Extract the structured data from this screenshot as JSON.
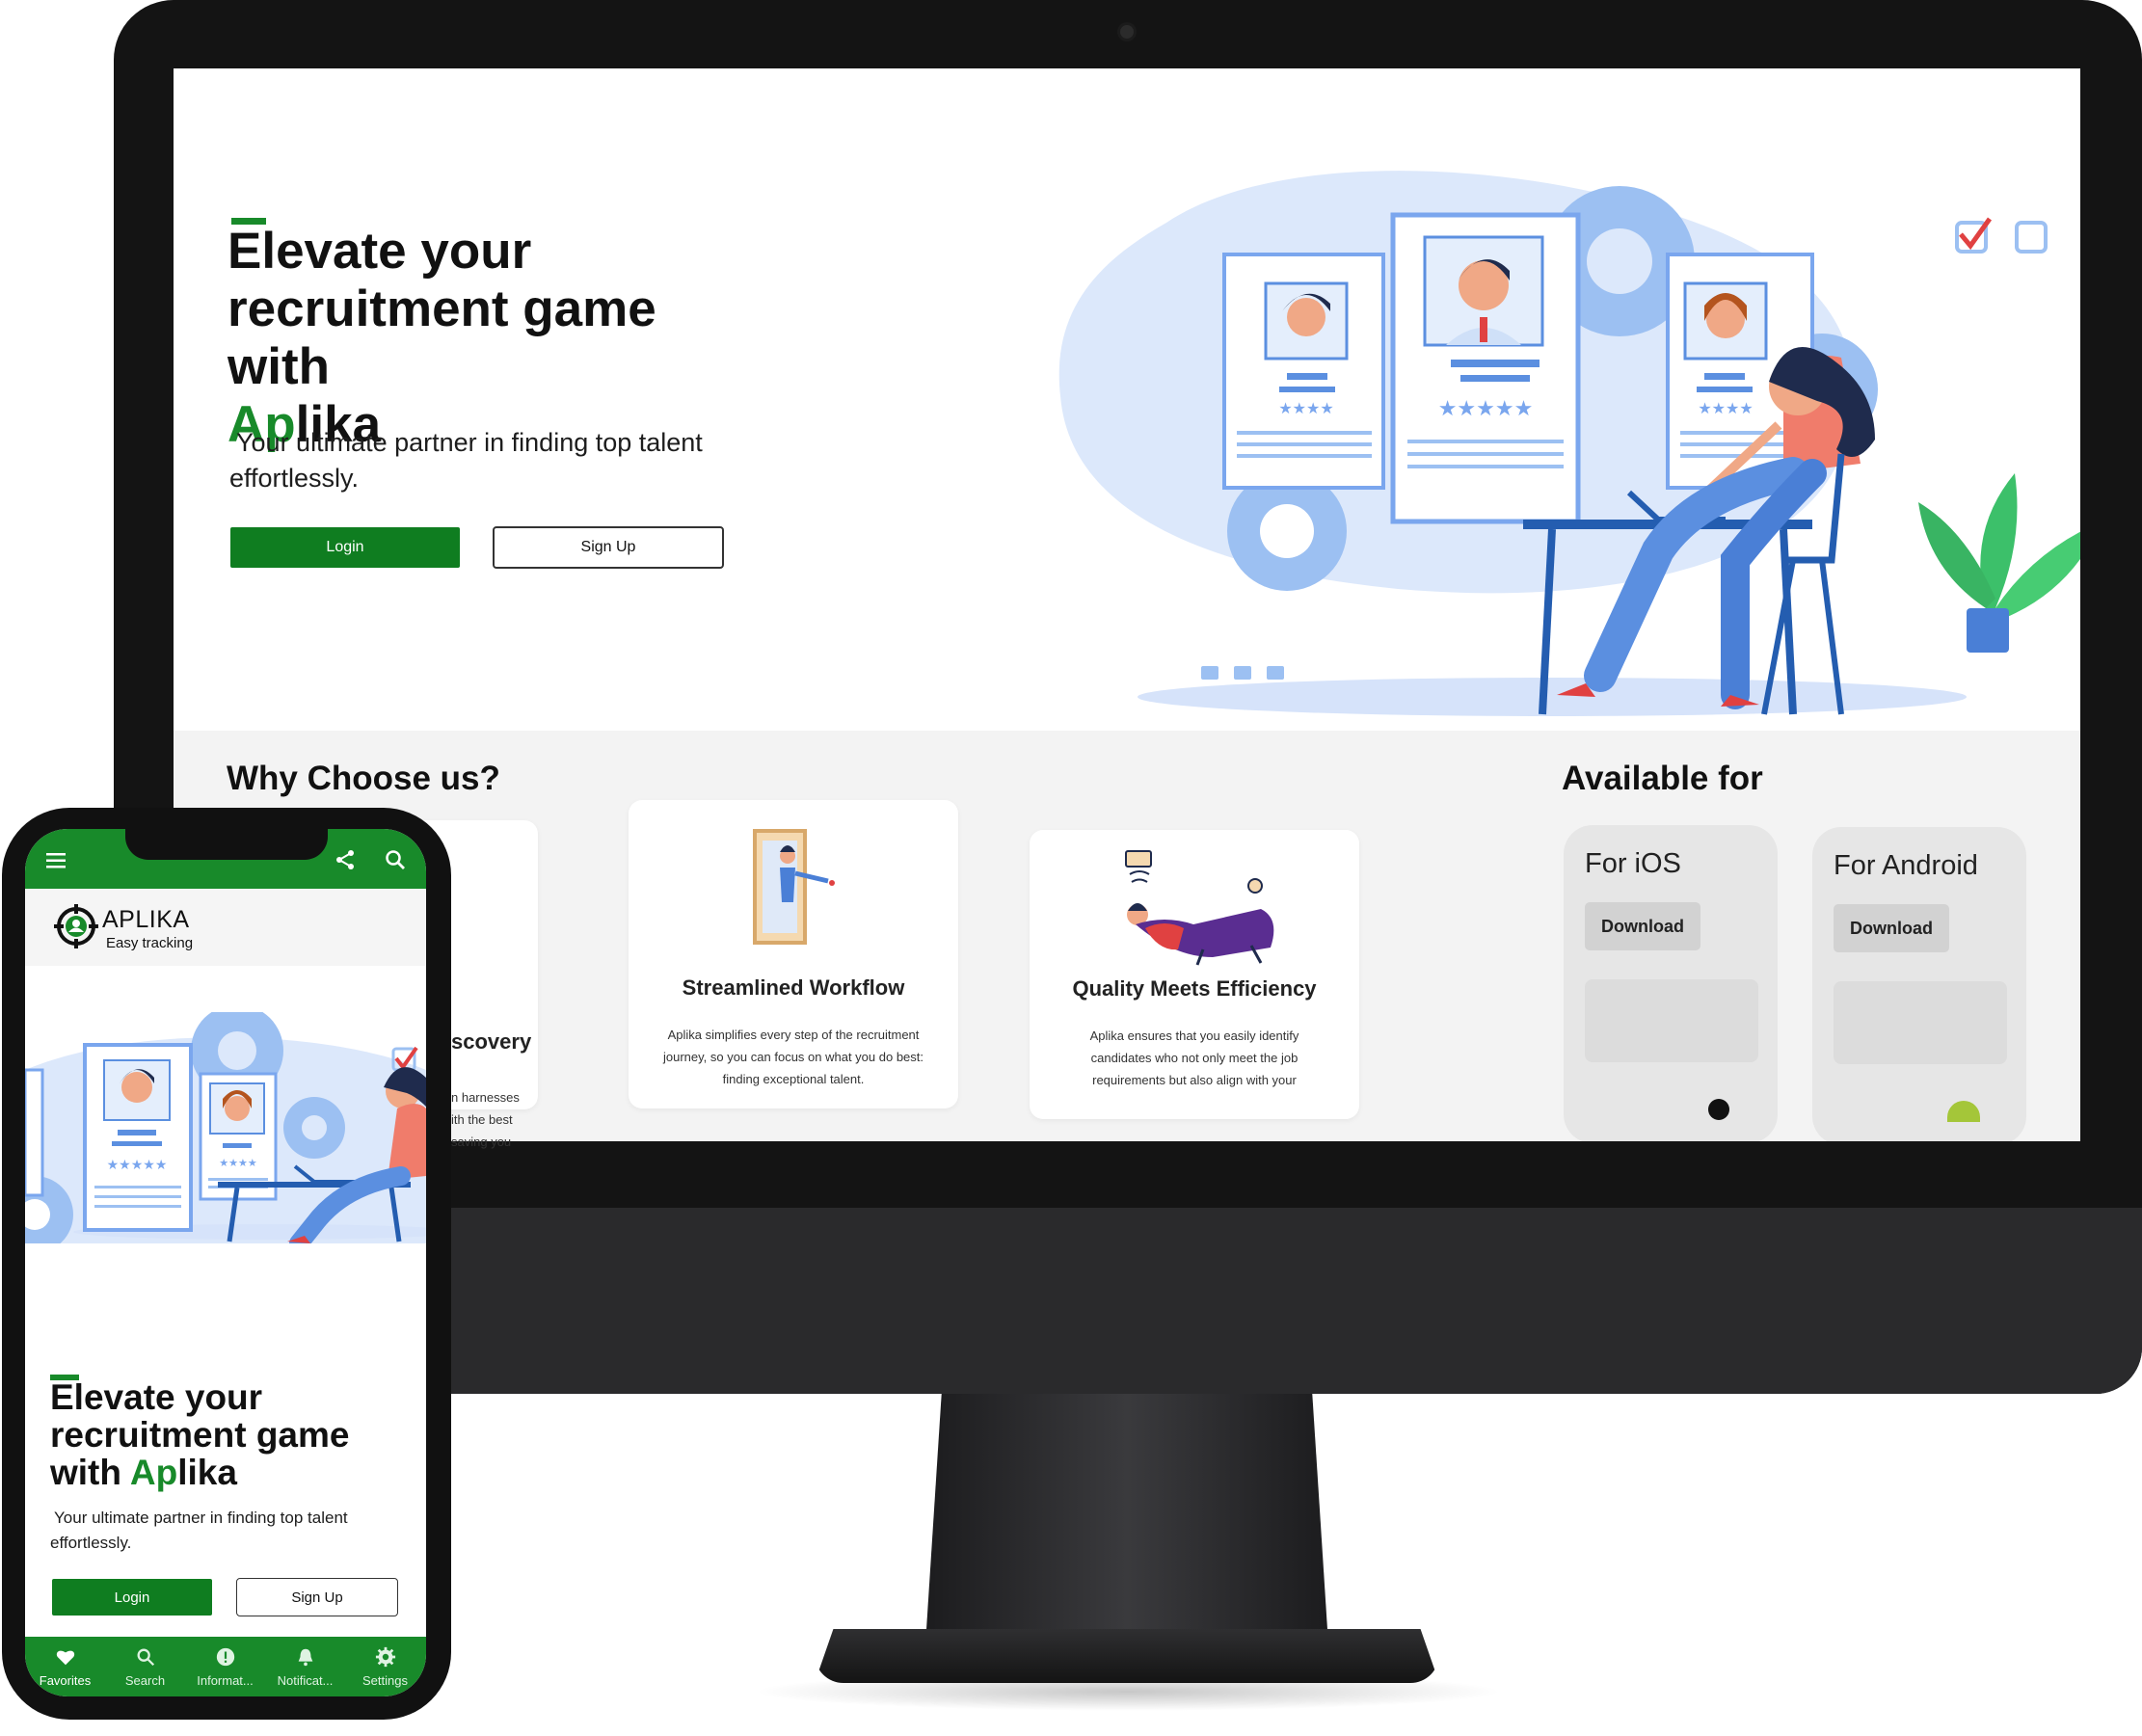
{
  "desktop": {
    "hero": {
      "title_line1": "Elevate your",
      "title_line2": "recruitment game with",
      "brand_green": "Ap",
      "brand_rest": "lika",
      "subtitle_line1": "Your ultimate partner in finding top talent",
      "subtitle_line2": "effortlessly.",
      "login_label": "Login",
      "signup_label": "Sign Up"
    },
    "why": {
      "heading": "Why Choose us?",
      "cards": [
        {
          "title": "Streamlined Workflow",
          "text": "Aplika simplifies every step of the recruitment journey, so you can focus on what you do best: finding exceptional talent."
        },
        {
          "title": "Quality Meets Efficiency",
          "text": "Aplika ensures that you easily identify candidates who not only meet the job requirements but also align with your"
        }
      ]
    },
    "available": {
      "heading": "Available for",
      "ios_title": "For iOS",
      "ios_button": "Download",
      "android_title": "For Android",
      "android_button": "Download"
    }
  },
  "phone": {
    "logo_name": "APLIKA",
    "logo_tagline": "Easy tracking",
    "partial_card_title": "scovery",
    "partial_card_line1": "n harnesses",
    "partial_card_line2": "ith the best",
    "partial_card_line3": "saving you",
    "hero": {
      "title_line1": "Elevate your",
      "title_line2": "recruitment game",
      "title_line3_prefix": "with ",
      "brand_green": "Ap",
      "brand_rest": "lika",
      "subtitle_line1": "Your ultimate partner in finding top talent",
      "subtitle_line2": "effortlessly.",
      "login_label": "Login",
      "signup_label": "Sign Up"
    },
    "bottom_nav": [
      {
        "label": "Favorites",
        "icon": "heart-icon"
      },
      {
        "label": "Search",
        "icon": "search-icon"
      },
      {
        "label": "Informat...",
        "icon": "info-icon"
      },
      {
        "label": "Notificat...",
        "icon": "bell-icon"
      },
      {
        "label": "Settings",
        "icon": "gear-icon"
      }
    ]
  },
  "colors": {
    "brand_green": "#188a2a",
    "illustration_blue": "#5b8fe0",
    "section_gray": "#f3f3f3"
  }
}
